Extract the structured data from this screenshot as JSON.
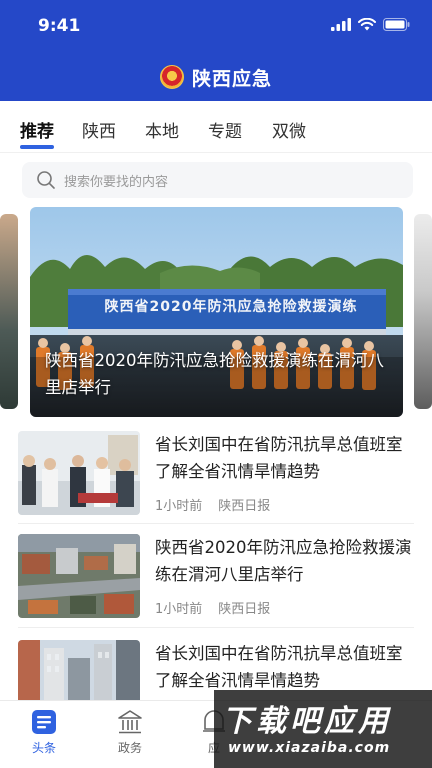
{
  "status": {
    "time": "9:41"
  },
  "header": {
    "title": "陕西应急"
  },
  "tabs": [
    {
      "label": "推荐",
      "active": true
    },
    {
      "label": "陕西",
      "active": false
    },
    {
      "label": "本地",
      "active": false
    },
    {
      "label": "专题",
      "active": false
    },
    {
      "label": "双微",
      "active": false
    }
  ],
  "search": {
    "placeholder": "搜索你要找的内容"
  },
  "banner": {
    "caption": "陕西省2020年防汛应急抢险救援演练在渭河八里店举行",
    "stage_text": "陕西省2020年防汛应急抢险救援演练"
  },
  "news": [
    {
      "title": "省长刘国中在省防汛抗旱总值班室了解全省汛情旱情趋势",
      "time": "1小时前",
      "source": "陕西日报"
    },
    {
      "title": "陕西省2020年防汛应急抢险救援演练在渭河八里店举行",
      "time": "1小时前",
      "source": "陕西日报"
    },
    {
      "title": "省长刘国中在省防汛抗旱总值班室了解全省汛情旱情趋势",
      "time": "",
      "source": ""
    }
  ],
  "nav": [
    {
      "label": "头条",
      "icon": "news-icon",
      "active": true
    },
    {
      "label": "政务",
      "icon": "government-icon",
      "active": false
    },
    {
      "label": "应",
      "icon": "emergency-icon",
      "active": false
    }
  ],
  "watermark": {
    "main": "下载吧应用",
    "sub": "www.xiazaiba.com"
  },
  "colors": {
    "brand": "#2548c8",
    "accent": "#2f62e0"
  }
}
